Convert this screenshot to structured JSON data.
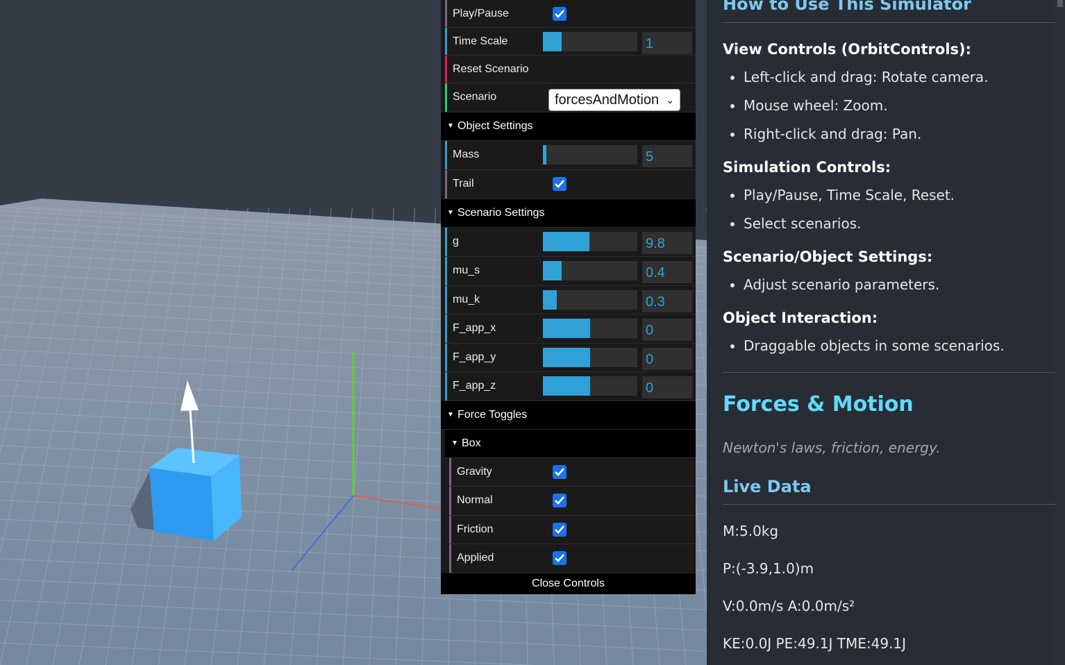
{
  "gui": {
    "play_pause": {
      "label": "Play/Pause",
      "checked": true,
      "color": "#806787"
    },
    "time_scale": {
      "label": "Time Scale",
      "value": "1",
      "fraction": 0.2
    },
    "reset": {
      "label": "Reset Scenario"
    },
    "scenario": {
      "label": "Scenario",
      "selected": "forcesAndMotion"
    },
    "object_settings": {
      "title": "Object Settings",
      "mass": {
        "label": "Mass",
        "value": "5",
        "fraction": 0.04
      },
      "trail": {
        "label": "Trail",
        "checked": true
      }
    },
    "scenario_settings": {
      "title": "Scenario Settings",
      "params": [
        {
          "label": "g",
          "value": "9.8",
          "fraction": 0.49
        },
        {
          "label": "mu_s",
          "value": "0.4",
          "fraction": 0.2
        },
        {
          "label": "mu_k",
          "value": "0.3",
          "fraction": 0.15
        },
        {
          "label": "F_app_x",
          "value": "0",
          "fraction": 0.5
        },
        {
          "label": "F_app_y",
          "value": "0",
          "fraction": 0.5
        },
        {
          "label": "F_app_z",
          "value": "0",
          "fraction": 0.5
        }
      ]
    },
    "force_toggles": {
      "title": "Force Toggles",
      "box": {
        "title": "Box",
        "items": [
          {
            "label": "Gravity",
            "checked": true
          },
          {
            "label": "Normal",
            "checked": true
          },
          {
            "label": "Friction",
            "checked": true
          },
          {
            "label": "Applied",
            "checked": true
          }
        ]
      }
    },
    "close_label": "Close Controls"
  },
  "info": {
    "title": "How to Use This Simulator",
    "view_controls": {
      "heading": "View Controls (OrbitControls):",
      "items": [
        "Left-click and drag: Rotate camera.",
        "Mouse wheel: Zoom.",
        "Right-click and drag: Pan."
      ]
    },
    "simulation_controls": {
      "heading": "Simulation Controls:",
      "items": [
        "Play/Pause, Time Scale, Reset.",
        "Select scenarios."
      ]
    },
    "settings": {
      "heading": "Scenario/Object Settings:",
      "items": [
        "Adjust scenario parameters."
      ]
    },
    "interaction": {
      "heading": "Object Interaction:",
      "items": [
        "Draggable objects in some scenarios."
      ]
    },
    "scenario_title": "Forces & Motion",
    "scenario_desc": "Newton's laws, friction, energy.",
    "live_heading": "Live Data",
    "live": {
      "mass": "M:5.0kg",
      "position": "P:(-3.9,1.0)m",
      "velocity": "V:0.0m/s A:0.0m/s²",
      "energy": "KE:0.0J PE:49.1J TME:49.1J"
    }
  },
  "colors": {
    "slider_fill": "#2fa1d6",
    "checkbox": "#1a73e8",
    "cube": "#3ab0f5",
    "accent_title": "#61dafb"
  }
}
